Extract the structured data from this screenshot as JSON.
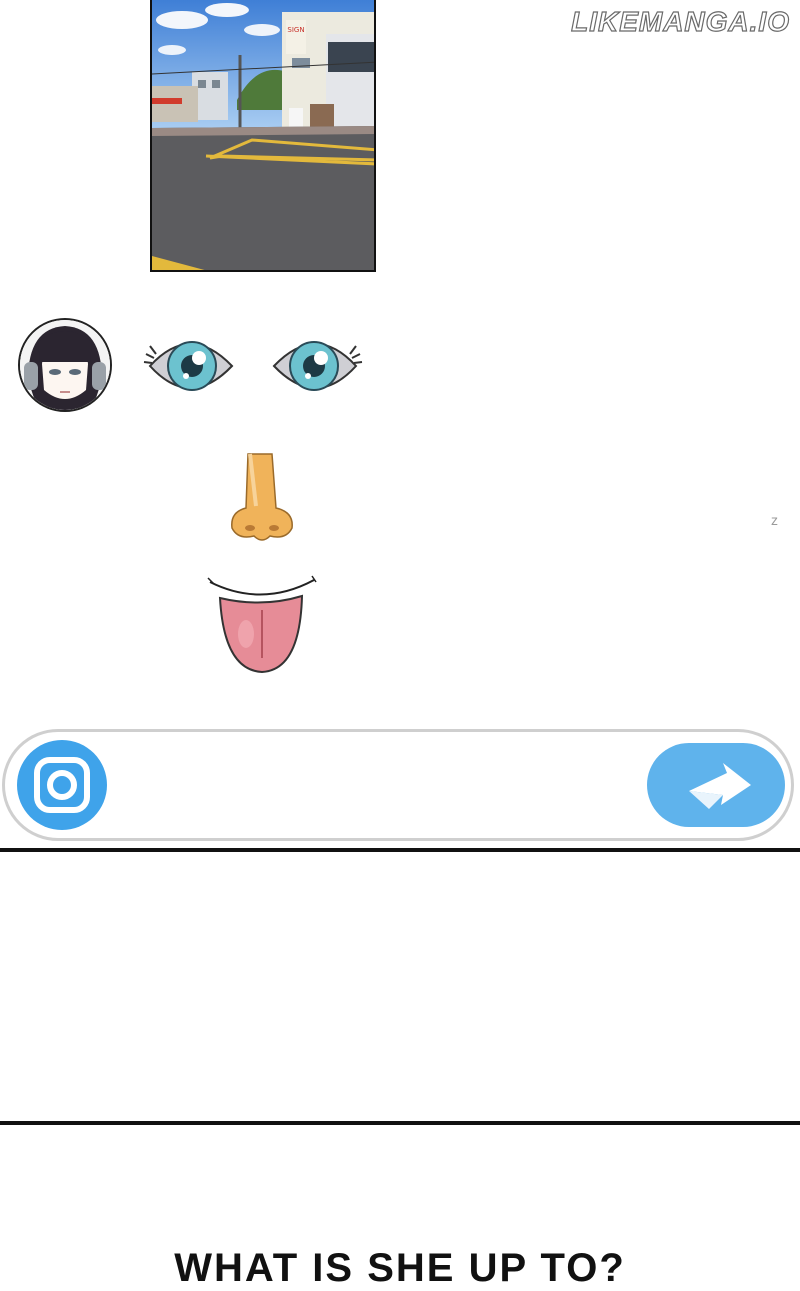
{
  "watermark": {
    "text": "LIKEMANGA.IO"
  },
  "chat": {
    "photo": {
      "subject": "street-corner-photo",
      "sign_text": ""
    },
    "avatar": {
      "name": "girl-avatar"
    },
    "stickers": [
      "eye-icon",
      "eye-icon",
      "nose-icon",
      "tongue-icon"
    ],
    "typing_mark": "z"
  },
  "input_bar": {
    "left_icon": "camera-app-icon",
    "send_icon": "send-arrow-icon",
    "colors": {
      "button": "#3fa3ea",
      "send": "#5fb3ec",
      "border": "#cfcfcf"
    }
  },
  "caption": {
    "text": "WHAT IS SHE UP TO?"
  }
}
